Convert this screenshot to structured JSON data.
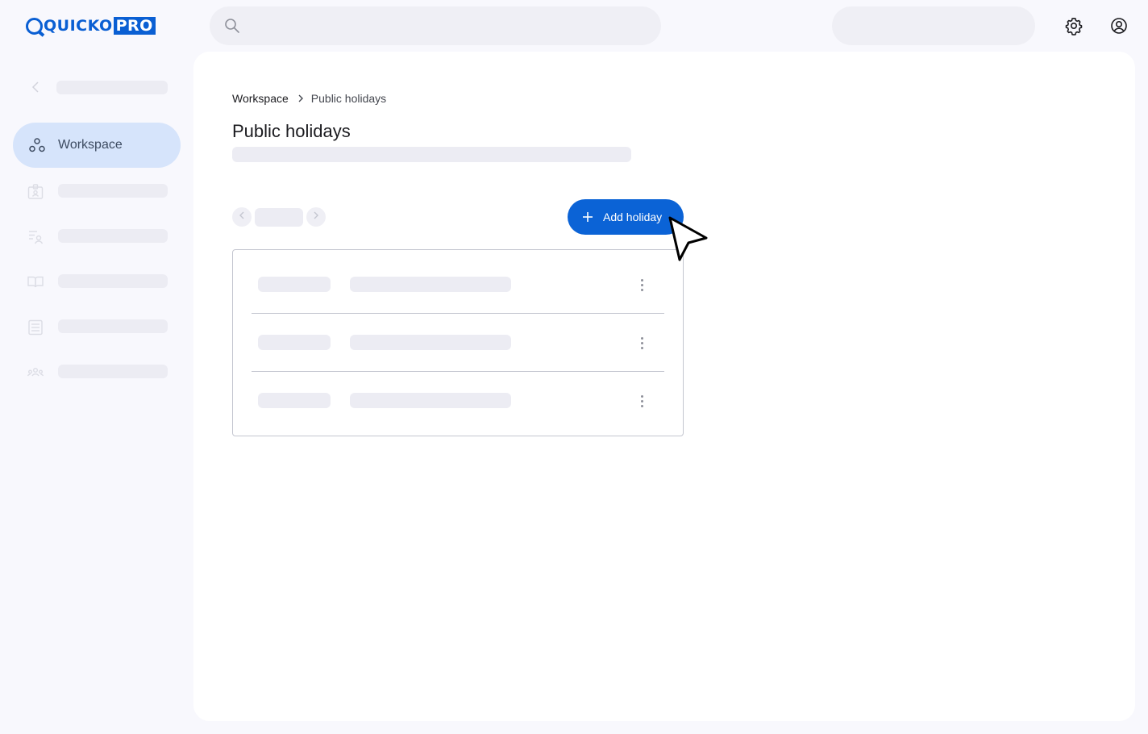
{
  "brand": {
    "logo_text": "QUICKO",
    "logo_badge": "PRO",
    "color": "#0a5fd3"
  },
  "header": {
    "search_icon": "search-icon",
    "settings_icon": "gear-icon",
    "account_icon": "account-circle-icon"
  },
  "sidebar": {
    "active_item": {
      "label": "Workspace",
      "icon": "workspace-icon"
    },
    "items": [
      {
        "icon": "id-badge-icon"
      },
      {
        "icon": "list-person-icon"
      },
      {
        "icon": "book-icon"
      },
      {
        "icon": "document-list-icon"
      },
      {
        "icon": "group-icon"
      }
    ]
  },
  "breadcrumb": {
    "items": [
      "Workspace",
      "Public holidays"
    ]
  },
  "page": {
    "title": "Public holidays",
    "add_button_label": "Add holiday",
    "table_rows": 3
  },
  "colors": {
    "accent": "#0b63d6",
    "active_nav_bg": "#d6e4fb",
    "skeleton": "#ececf3",
    "background": "#f8f8fd"
  }
}
